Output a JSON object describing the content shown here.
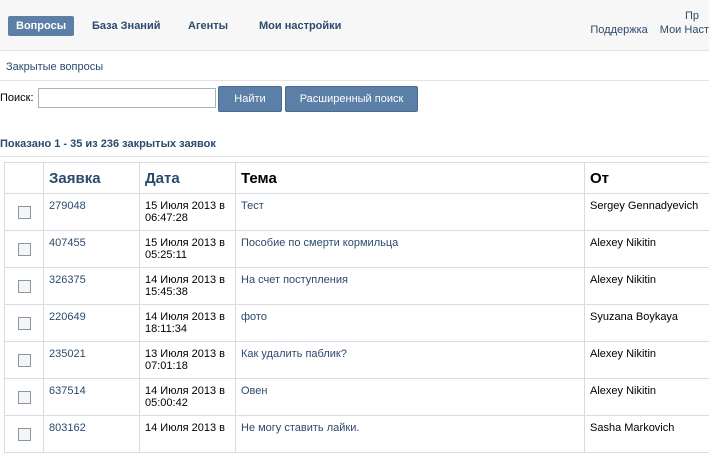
{
  "nav": {
    "tabs": [
      "Вопросы",
      "База Знаний",
      "Агенты",
      "Мои настройки"
    ],
    "active_index": 0,
    "right_line1": "Пр",
    "right_line2": [
      "Поддержка",
      "Мои Наст"
    ]
  },
  "subnav": {
    "label": "Закрытые вопросы"
  },
  "search": {
    "label": "Поиск:",
    "value": "",
    "find_button": "Найти",
    "advanced_button": "Расширенный поиск"
  },
  "summary": {
    "text": "Показано  1 - 35 из 236   закрытых заявок"
  },
  "table": {
    "columns": [
      "Заявка",
      "Дата",
      "Тема",
      "От"
    ],
    "rows": [
      {
        "id": "279048",
        "date": "15 Июля 2013 в",
        "time": "06:47:28",
        "subject": "Тест",
        "from": "Sergey Gennadyevich"
      },
      {
        "id": "407455",
        "date": "15 Июля 2013 в",
        "time": "05:25:11",
        "subject": "Пособие по смерти кормильца",
        "from": "Alexey Nikitin"
      },
      {
        "id": "326375",
        "date": "14 Июля 2013 в",
        "time": "15:45:38",
        "subject": "На счет поступления",
        "from": "Alexey Nikitin"
      },
      {
        "id": "220649",
        "date": "14 Июля 2013 в",
        "time": "18:11:34",
        "subject": "фото",
        "from": "Syuzana Boykaya"
      },
      {
        "id": "235021",
        "date": "13 Июля 2013 в",
        "time": "07:01:18",
        "subject": "Как удалить паблик?",
        "from": "Alexey Nikitin"
      },
      {
        "id": "637514",
        "date": "14 Июля 2013 в",
        "time": "05:00:42",
        "subject": "Овен",
        "from": "Alexey Nikitin"
      },
      {
        "id": "803162",
        "date": "14 Июля 2013 в",
        "time": "",
        "subject": "Не могу ставить лайки.",
        "from": "Sasha Markovich"
      }
    ]
  }
}
